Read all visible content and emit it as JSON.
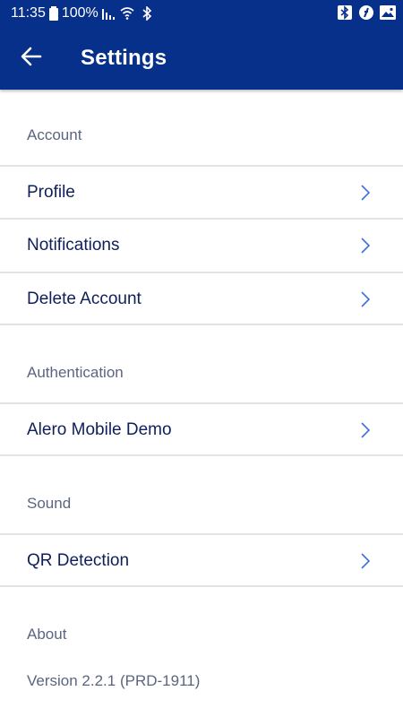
{
  "status_bar": {
    "time": "11:35",
    "battery": "100%",
    "icons": [
      "battery-icon",
      "signal-icon",
      "wifi-icon",
      "bluetooth-icon",
      "bluetooth-icon",
      "app-icon",
      "image-icon"
    ]
  },
  "app_bar": {
    "title": "Settings",
    "background_color": "#06308a"
  },
  "sections": {
    "account": {
      "label": "Account",
      "items": [
        "Profile",
        "Notifications",
        "Delete Account"
      ]
    },
    "authentication": {
      "label": "Authentication",
      "items": [
        "Alero Mobile Demo"
      ]
    },
    "sound": {
      "label": "Sound",
      "items": [
        "QR Detection"
      ]
    },
    "about": {
      "label": "About",
      "version": "Version 2.2.1 (PRD-1911)"
    }
  },
  "colors": {
    "accent": "#3d6fe0",
    "item_text": "#0f1f5a",
    "section_text": "#5c6580"
  }
}
